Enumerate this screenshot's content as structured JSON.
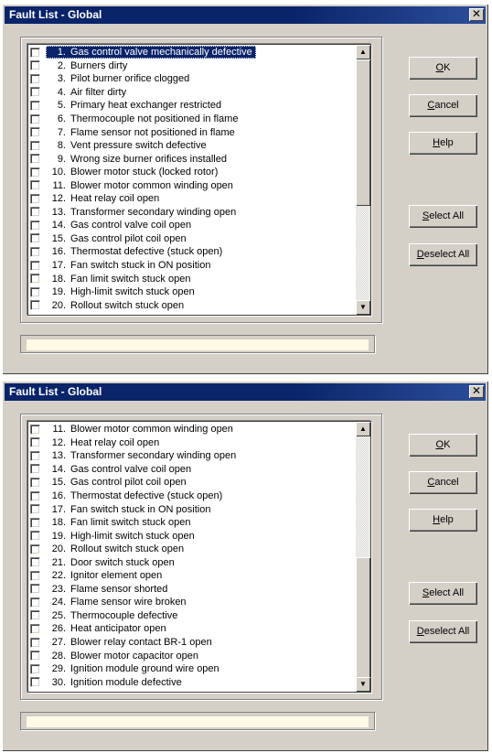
{
  "dialogs": [
    {
      "title": "Fault List - Global",
      "close_label": "✕",
      "items": [
        {
          "num": "1.",
          "label": "Gas control valve mechanically defective",
          "selected": true
        },
        {
          "num": "2.",
          "label": "Burners dirty"
        },
        {
          "num": "3.",
          "label": "Pilot burner orifice clogged"
        },
        {
          "num": "4.",
          "label": "Air filter dirty"
        },
        {
          "num": "5.",
          "label": "Primary heat exchanger restricted"
        },
        {
          "num": "6.",
          "label": "Thermocouple not positioned in flame"
        },
        {
          "num": "7.",
          "label": "Flame sensor not positioned in flame"
        },
        {
          "num": "8.",
          "label": "Vent pressure switch defective"
        },
        {
          "num": "9.",
          "label": "Wrong size burner orifices installed"
        },
        {
          "num": "10.",
          "label": "Blower motor stuck (locked rotor)"
        },
        {
          "num": "11.",
          "label": "Blower motor common winding open"
        },
        {
          "num": "12.",
          "label": "Heat relay coil open"
        },
        {
          "num": "13.",
          "label": "Transformer secondary winding open"
        },
        {
          "num": "14.",
          "label": "Gas control valve coil open"
        },
        {
          "num": "15.",
          "label": "Gas control pilot coil open"
        },
        {
          "num": "16.",
          "label": "Thermostat defective (stuck open)"
        },
        {
          "num": "17.",
          "label": "Fan switch stuck in ON position"
        },
        {
          "num": "18.",
          "label": "Fan limit switch stuck open"
        },
        {
          "num": "19.",
          "label": "High-limit switch stuck open"
        },
        {
          "num": "20.",
          "label": "Rollout switch stuck open"
        }
      ],
      "buttons": {
        "ok": "OK",
        "cancel": "Cancel",
        "help": "Help",
        "select_all": "Select All",
        "deselect_all": "Deselect All"
      },
      "status_text": ""
    },
    {
      "title": "Fault List - Global",
      "close_label": "✕",
      "items": [
        {
          "num": "11.",
          "label": "Blower motor common winding open"
        },
        {
          "num": "12.",
          "label": "Heat relay coil open"
        },
        {
          "num": "13.",
          "label": "Transformer secondary winding open"
        },
        {
          "num": "14.",
          "label": "Gas control valve coil open"
        },
        {
          "num": "15.",
          "label": "Gas control pilot coil open"
        },
        {
          "num": "16.",
          "label": "Thermostat defective (stuck open)"
        },
        {
          "num": "17.",
          "label": "Fan switch stuck in ON position"
        },
        {
          "num": "18.",
          "label": "Fan limit switch stuck open"
        },
        {
          "num": "19.",
          "label": "High-limit switch stuck open"
        },
        {
          "num": "20.",
          "label": "Rollout switch stuck open"
        },
        {
          "num": "21.",
          "label": "Door switch stuck open"
        },
        {
          "num": "22.",
          "label": "Ignitor element open"
        },
        {
          "num": "23.",
          "label": "Flame sensor shorted"
        },
        {
          "num": "24.",
          "label": "Flame sensor wire broken"
        },
        {
          "num": "25.",
          "label": "Thermocouple defective"
        },
        {
          "num": "26.",
          "label": "Heat anticipator open"
        },
        {
          "num": "27.",
          "label": "Blower relay contact BR-1 open"
        },
        {
          "num": "28.",
          "label": "Blower motor capacitor open"
        },
        {
          "num": "29.",
          "label": "Ignition module ground wire open"
        },
        {
          "num": "30.",
          "label": "Ignition module defective"
        }
      ],
      "buttons": {
        "ok": "OK",
        "cancel": "Cancel",
        "help": "Help",
        "select_all": "Select All",
        "deselect_all": "Deselect All"
      },
      "status_text": ""
    }
  ],
  "icons": {
    "scroll_up": "arrow-up-icon",
    "scroll_down": "arrow-down-icon"
  },
  "colors": {
    "titlebar": "#0a246a",
    "face": "#d4d0c8",
    "selection": "#0a246a",
    "status_field": "#fffae6"
  }
}
